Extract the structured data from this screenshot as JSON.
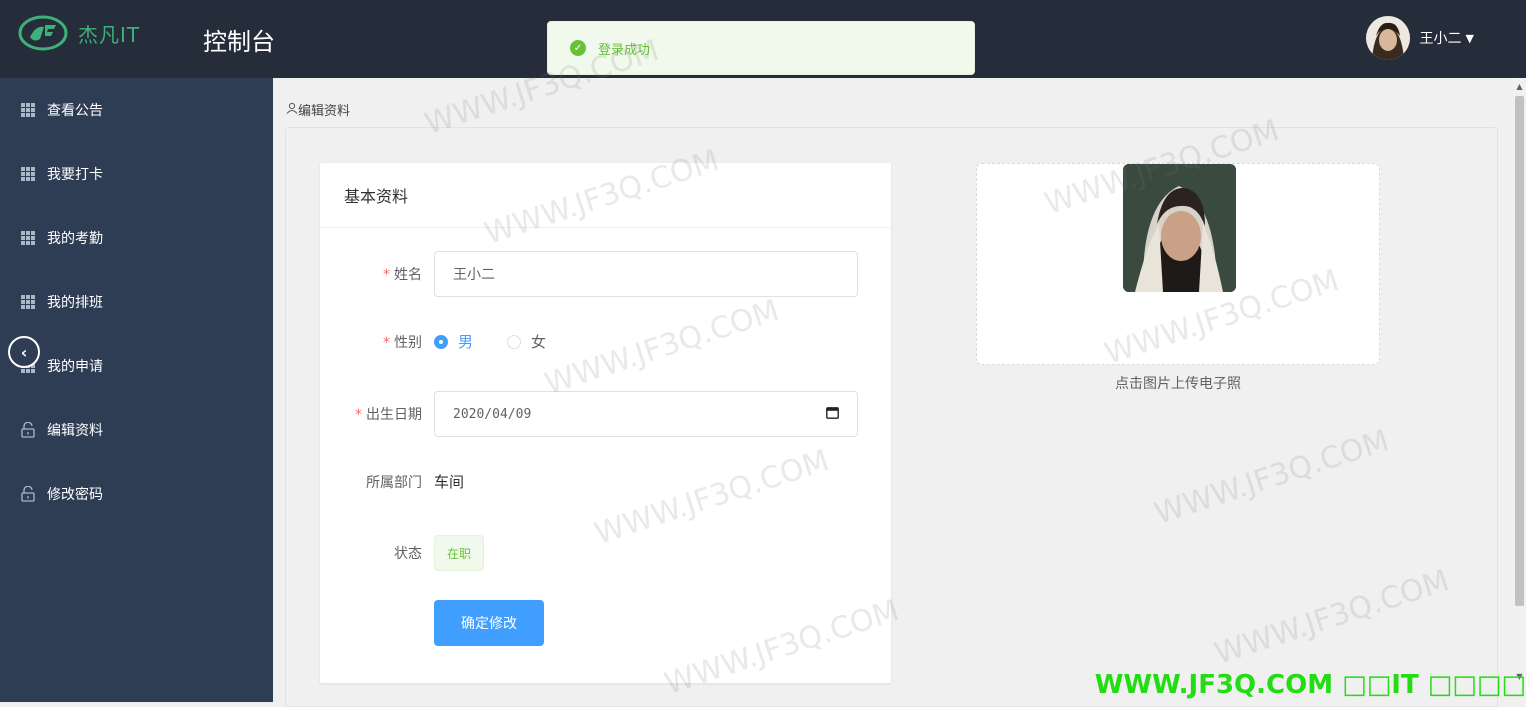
{
  "header": {
    "logo_text": "杰凡IT",
    "console_title": "控制台",
    "username": "王小二"
  },
  "toast": {
    "message": "登录成功"
  },
  "sidebar": {
    "items": [
      {
        "label": "查看公告",
        "icon": "grid-icon"
      },
      {
        "label": "我要打卡",
        "icon": "grid-icon"
      },
      {
        "label": "我的考勤",
        "icon": "grid-icon"
      },
      {
        "label": "我的排班",
        "icon": "grid-icon"
      },
      {
        "label": "我的申请",
        "icon": "grid-icon"
      },
      {
        "label": "编辑资料",
        "icon": "lock-icon"
      },
      {
        "label": "修改密码",
        "icon": "lock-icon"
      }
    ]
  },
  "breadcrumb": "编辑资料",
  "form": {
    "card_title": "基本资料",
    "name_label": "姓名",
    "name_value": "王小二",
    "gender_label": "性别",
    "gender_options": [
      "男",
      "女"
    ],
    "gender_selected": "男",
    "birth_label": "出生日期",
    "birth_value": "2020/04/09",
    "dept_label": "所属部门",
    "dept_value": "车间",
    "status_label": "状态",
    "status_value": "在职",
    "submit_label": "确定修改"
  },
  "upload": {
    "caption": "点击图片上传电子照"
  },
  "watermark": {
    "repeat_text": "WWW.JF3Q.COM",
    "bottom_text": "WWW.JF3Q.COM □□IT □□□□"
  },
  "colors": {
    "header_bg": "#252c3a",
    "sidebar_bg": "#2f3d54",
    "primary": "#409eff",
    "success": "#67c23a",
    "required": "#f56c6c",
    "logo_green": "#3fb07a"
  }
}
